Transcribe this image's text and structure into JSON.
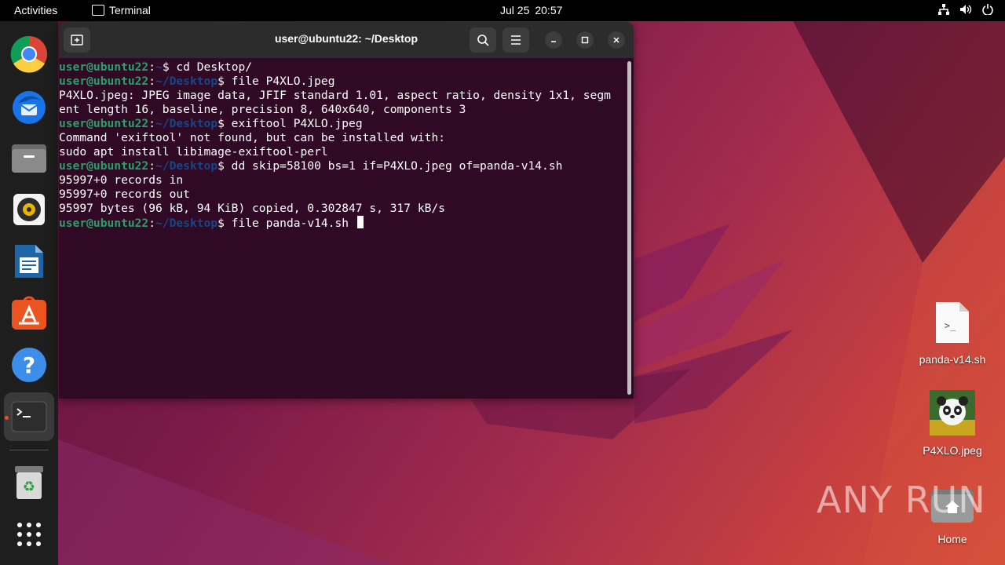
{
  "topbar": {
    "activities": "Activities",
    "app_name": "Terminal",
    "date": "Jul 25",
    "time": "20:57"
  },
  "dock": {
    "items": [
      "chrome-icon",
      "thunderbird-icon",
      "files-icon",
      "rhythmbox-icon",
      "writer-icon",
      "app-center-icon",
      "help-icon",
      "terminal-icon",
      "trash-icon",
      "app-grid-icon"
    ]
  },
  "terminal": {
    "title": "user@ubuntu22: ~/Desktop",
    "lines": [
      {
        "user": "user@ubuntu22",
        "path": "~",
        "cmd": "$ cd Desktop/"
      },
      {
        "user": "user@ubuntu22",
        "path": "~/Desktop",
        "cmd": "$ file P4XLO.jpeg"
      },
      {
        "text": "P4XLO.jpeg: JPEG image data, JFIF standard 1.01, aspect ratio, density 1x1, segm"
      },
      {
        "text": "ent length 16, baseline, precision 8, 640x640, components 3"
      },
      {
        "user": "user@ubuntu22",
        "path": "~/Desktop",
        "cmd": "$ exiftool P4XLO.jpeg"
      },
      {
        "text": "Command 'exiftool' not found, but can be installed with:"
      },
      {
        "text": "sudo apt install libimage-exiftool-perl"
      },
      {
        "user": "user@ubuntu22",
        "path": "~/Desktop",
        "cmd": "$ dd skip=58100 bs=1 if=P4XLO.jpeg of=panda-v14.sh"
      },
      {
        "text": "95997+0 records in"
      },
      {
        "text": "95997+0 records out"
      },
      {
        "text": "95997 bytes (96 kB, 94 KiB) copied, 0.302847 s, 317 kB/s"
      },
      {
        "user": "user@ubuntu22",
        "path": "~/Desktop",
        "cmd": "$ file panda-v14.sh "
      }
    ]
  },
  "desktop": {
    "icons": [
      {
        "label": "panda-v14.sh"
      },
      {
        "label": "P4XLO.jpeg"
      },
      {
        "label": "Home"
      }
    ]
  },
  "watermark": "ANY RUN"
}
